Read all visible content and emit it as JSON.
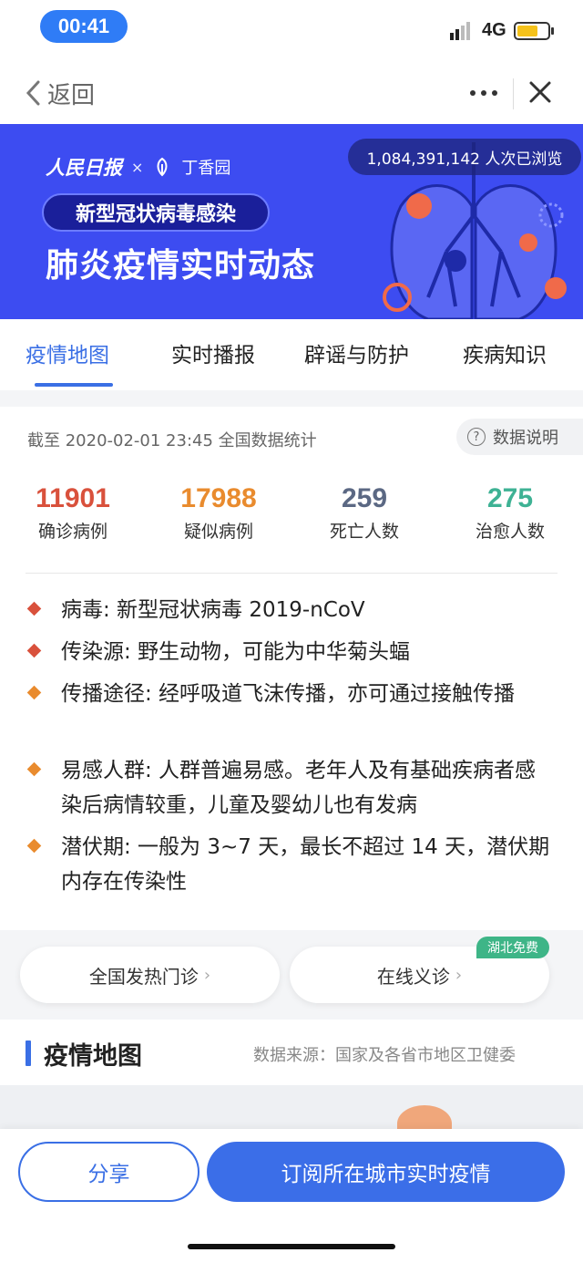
{
  "status_bar": {
    "time": "00:41",
    "network": "4G"
  },
  "nav": {
    "back_label": "返回",
    "more_icon": "more-dots-icon",
    "close_icon": "close-icon"
  },
  "banner": {
    "views": "1,084,391,142 人次已浏览",
    "brand_a": "人民日报",
    "brand_x": "×",
    "brand_b": "丁香园",
    "tag": "新型冠状病毒感染",
    "headline": "肺炎疫情实时动态"
  },
  "tabs": [
    {
      "label": "疫情地图",
      "active": true
    },
    {
      "label": "实时播报",
      "active": false
    },
    {
      "label": "辟谣与防护",
      "active": false
    },
    {
      "label": "疾病知识",
      "active": false
    }
  ],
  "stats": {
    "timestamp": "截至 2020-02-01 23:45 全国数据统计",
    "help_label": "数据说明",
    "items": [
      {
        "value": "11901",
        "label": "确诊病例",
        "color": "#d9513c"
      },
      {
        "value": "17988",
        "label": "疑似病例",
        "color": "#e98b2e"
      },
      {
        "value": "259",
        "label": "死亡人数",
        "color": "#5b6883"
      },
      {
        "value": "275",
        "label": "治愈人数",
        "color": "#3eb294"
      }
    ]
  },
  "facts": [
    {
      "text": "病毒: 新型冠状病毒 2019-nCoV",
      "color": "#d9513c"
    },
    {
      "text": "传染源: 野生动物，可能为中华菊头蝠",
      "color": "#d9513c"
    },
    {
      "text": "传播途径: 经呼吸道飞沫传播，亦可通过接触传播",
      "color": "#e98b2e"
    },
    {
      "text": "易感人群: 人群普遍易感。老年人及有基础疾病者感染后病情较重，儿童及婴幼儿也有发病",
      "color": "#e98b2e"
    },
    {
      "text": "潜伏期: 一般为 3~7 天，最长不超过 14 天，潜伏期内存在传染性",
      "color": "#e98b2e"
    }
  ],
  "services": {
    "fever_clinic": "全国发热门诊",
    "online_consult": "在线义诊",
    "badge": "湖北免费"
  },
  "map_section": {
    "title": "疫情地图",
    "source": "数据来源：国家及各省市地区卫健委"
  },
  "bottom": {
    "share": "分享",
    "subscribe": "订阅所在城市实时疫情"
  }
}
